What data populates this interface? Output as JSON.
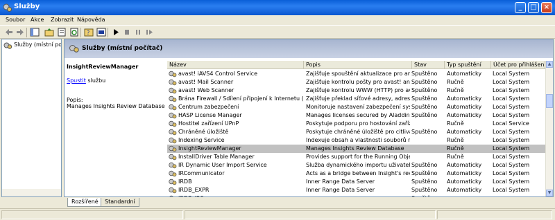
{
  "window": {
    "title": "Služby"
  },
  "menu": [
    "Soubor",
    "Akce",
    "Zobrazit",
    "Nápověda"
  ],
  "tree": {
    "item": "Služby (místní počít"
  },
  "header": {
    "title": "Služby (místní počítač)"
  },
  "details": {
    "service_name": "InsightReviewManager",
    "start_link": "Spustit",
    "start_suffix": " službu",
    "popis_label": "Popis:",
    "popis_text": "Manages Insights Review Database"
  },
  "table": {
    "columns": [
      "Název",
      "Popis",
      "Stav",
      "Typ spuštění",
      "Účet pro přihlášení"
    ],
    "rows": [
      [
        "avast! iAVS4 Control Service",
        "Zajišťuje spouštění aktualizace pro antivi...",
        "Spuštěno",
        "Automaticky",
        "Local System"
      ],
      [
        "avast! Mail Scanner",
        "Zajišťuje kontrolu pošty pro avast! antivi...",
        "Spuštěno",
        "Ručně",
        "Local System"
      ],
      [
        "avast! Web Scanner",
        "Zajišťuje kontrolu WWW (HTTP) pro ava...",
        "Spuštěno",
        "Ručně",
        "Local System"
      ],
      [
        "Brána Firewall / Sdílení připojení k Internetu (ICS)",
        "Zajišťuje překlad síťové adresy, adresov...",
        "Spuštěno",
        "Automaticky",
        "Local System"
      ],
      [
        "Centrum zabezpečení",
        "Monitoruje nastavení zabezpečení systé...",
        "Spuštěno",
        "Automaticky",
        "Local System"
      ],
      [
        "HASP License Manager",
        "Manages licenses secured by Aladdin HA...",
        "Spuštěno",
        "Automaticky",
        "Local System"
      ],
      [
        "Hostitel zařízení UPnP",
        "Poskytuje podporu pro hostování zařízen...",
        "",
        "Ručně",
        "Local Service"
      ],
      [
        "Chráněné úložiště",
        "Poskytuje chráněné úložiště pro citlivá d...",
        "Spuštěno",
        "Automaticky",
        "Local System"
      ],
      [
        "Indexing Service",
        "Indexuje obsah a vlastnosti souborů na ...",
        "",
        "Ručně",
        "Local System"
      ],
      [
        "InsightReviewManager",
        "Manages Insights Review Database",
        "",
        "Ručně",
        "Local System"
      ],
      [
        "InstallDriver Table Manager",
        "Provides support for the Running Object...",
        "",
        "Ručně",
        "Local System"
      ],
      [
        "IR Dynamic User Import Service",
        "Služba dynamického importu uživatel",
        "Spuštěno",
        "Automaticky",
        "Local System"
      ],
      [
        "IRCommunicator",
        "Acts as a bridge between Insight's revie...",
        "Spuštěno",
        "Automaticky",
        "Local System"
      ],
      [
        "IRDB",
        "Inner Range Data Server",
        "Spuštěno",
        "Automaticky",
        "Local System"
      ],
      [
        "IRDB_EXPR",
        "Inner Range Data Server",
        "Spuštěno",
        "Automaticky",
        "Local System"
      ],
      [
        "IRDB_IRS",
        "",
        "Spuštěno",
        "",
        ""
      ]
    ],
    "selected_row": 9
  },
  "tabs": [
    "Rozšířené",
    "Standardní"
  ],
  "colors": {
    "title_bar": "#0a5fd8",
    "selection": "#c1c1c1",
    "header_band": "#b4c1da",
    "link": "#0000ff"
  }
}
